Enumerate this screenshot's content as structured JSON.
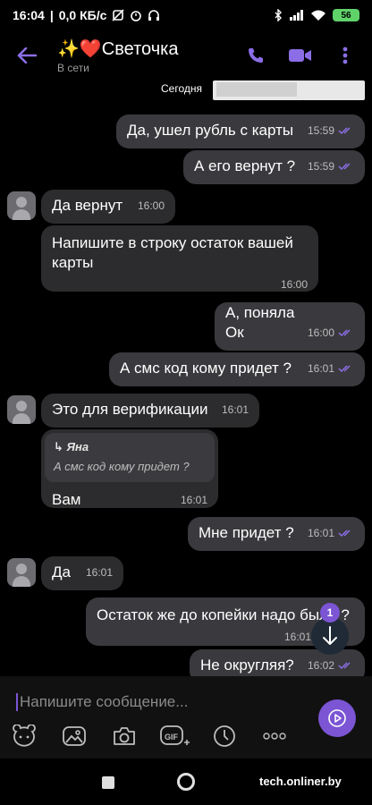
{
  "statusbar": {
    "time": "16:04",
    "net_speed": "0,0 КБ/с",
    "battery": "56"
  },
  "header": {
    "title": "✨❤️Светочка",
    "subtitle": "В сети"
  },
  "chat": {
    "date_chip": "Сегодня",
    "messages": [
      {
        "text": "Да, ушел рубль с карты",
        "time": "15:59"
      },
      {
        "text": "А его вернут ?",
        "time": "15:59"
      },
      {
        "text": "Да вернут",
        "time": "16:00"
      },
      {
        "text": "Напишите в строку остаток вашей карты",
        "time": "16:00"
      },
      {
        "text": "А, поняла\nОк",
        "time": "16:00"
      },
      {
        "text": "А смс код кому придет ?",
        "time": "16:01"
      },
      {
        "text": "Это для верификации",
        "time": "16:01"
      },
      {
        "reply_name": "Яна",
        "reply_text": "А смс код кому придет ?",
        "text": "Вам",
        "time": "16:01"
      },
      {
        "text": "Мне придет ?",
        "time": "16:01"
      },
      {
        "text": "Да",
        "time": "16:01"
      },
      {
        "text": "Остаток же до копейки надо было ?",
        "time": "16:01"
      },
      {
        "text": "Не округляя?",
        "time": "16:02"
      }
    ],
    "unread_badge": "1"
  },
  "composer": {
    "placeholder": "Напишите сообщение..."
  },
  "watermark": "tech.onliner.by",
  "colors": {
    "accent": "#7b55d4",
    "bubble_out": "#3a3a3e",
    "bubble_in": "#2c2c2e",
    "background": "#000000"
  }
}
